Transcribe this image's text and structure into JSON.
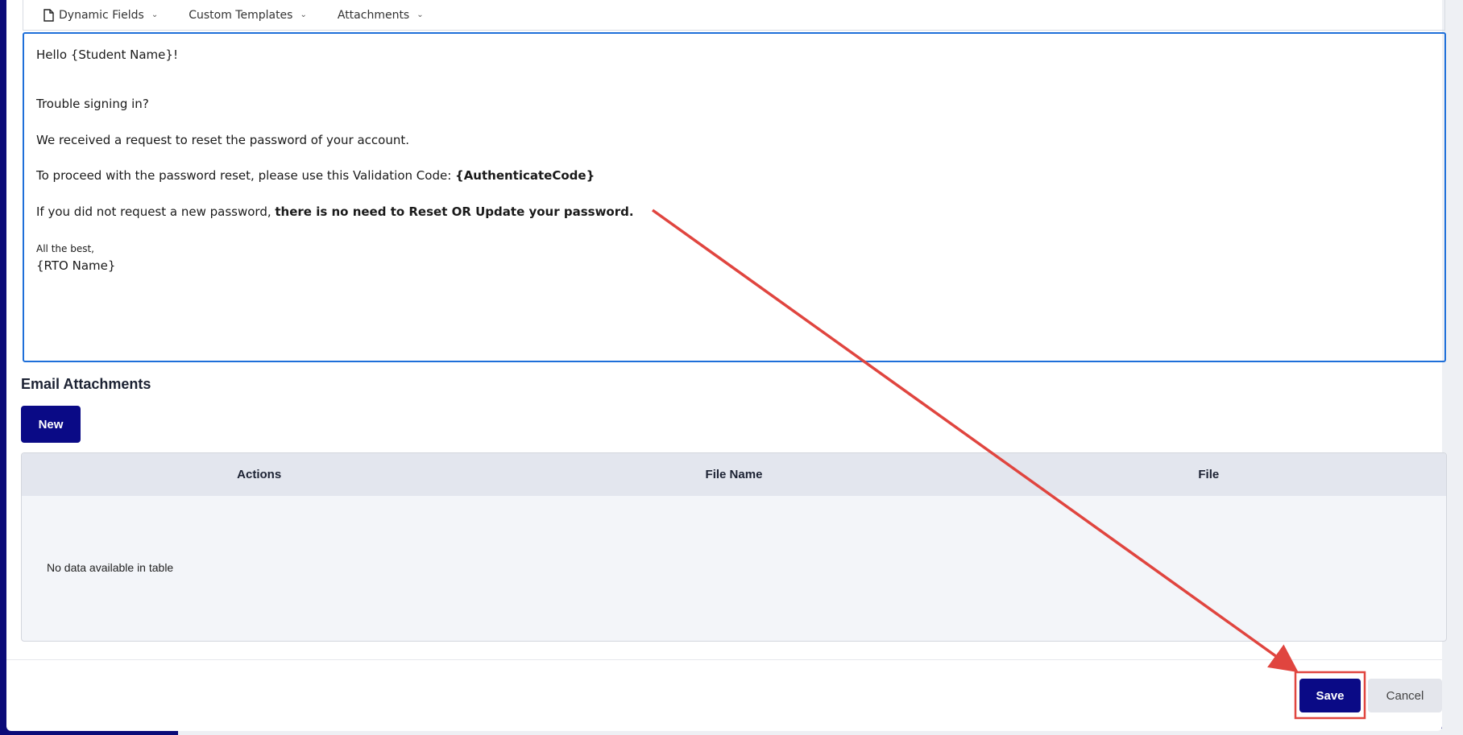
{
  "toolbar": {
    "dynamic_fields": "Dynamic Fields",
    "custom_templates": "Custom Templates",
    "attachments": "Attachments"
  },
  "editor": {
    "line1": "Hello {Student Name}!",
    "line2": "Trouble signing in?",
    "line3": "We received a request to reset the password of your account.",
    "line4_prefix": "To proceed with the password reset, please use this Validation Code: ",
    "line4_code": "{AuthenticateCode}",
    "line5_prefix": "If you did not request a new password, ",
    "line5_bold": "there is no need to Reset OR Update your password.",
    "line6": "All the best,",
    "line7": "{RTO Name}"
  },
  "attachments_section": {
    "title": "Email Attachments",
    "new_label": "New",
    "columns": [
      "Actions",
      "File Name",
      "File"
    ],
    "empty_text": "No data available in table"
  },
  "footer": {
    "save_label": "Save",
    "cancel_label": "Cancel"
  },
  "colors": {
    "primary": "#0a0a86",
    "focus_border": "#1e6fd9",
    "annotation": "#e0453f"
  }
}
